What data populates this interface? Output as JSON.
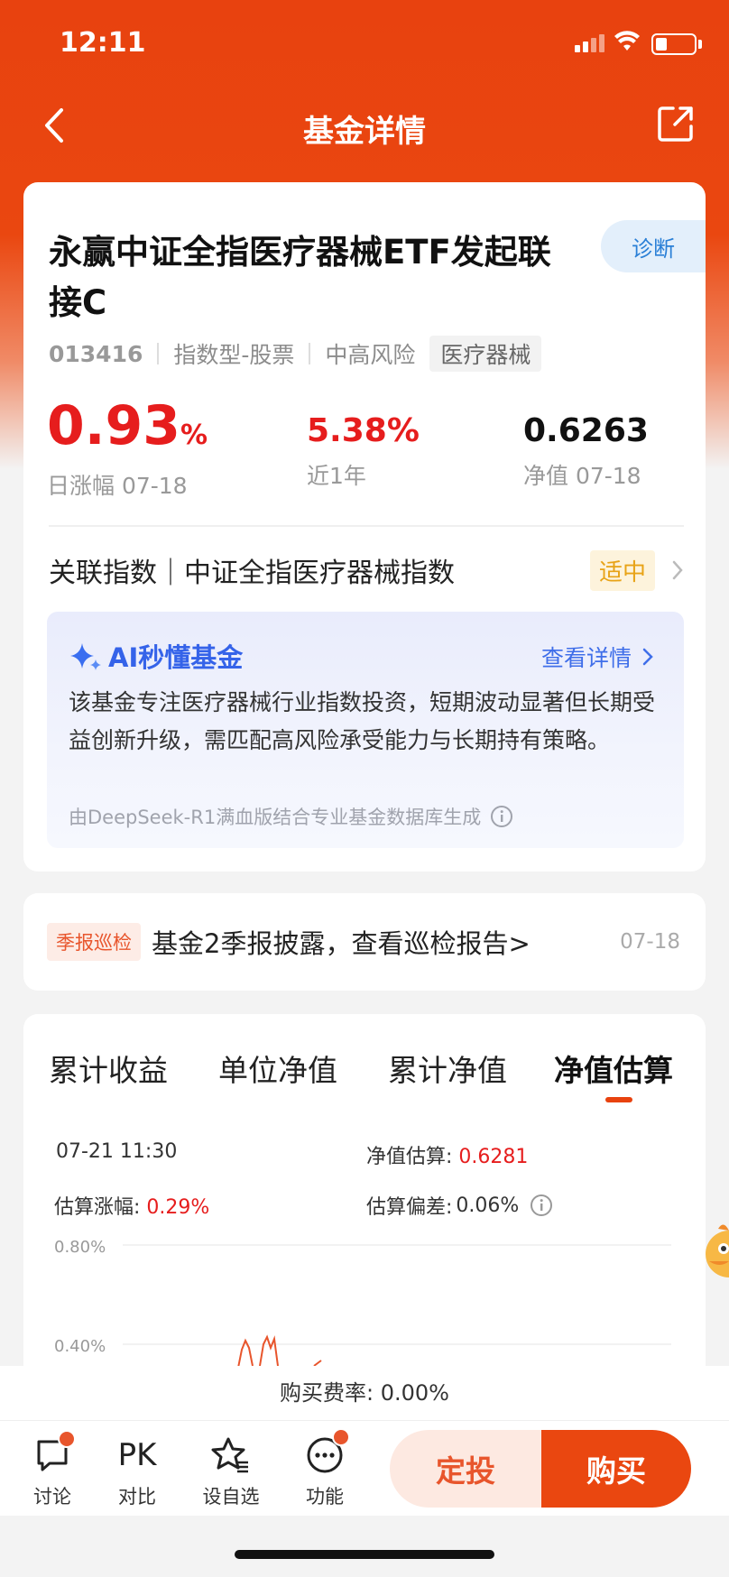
{
  "status": {
    "time": "12:11"
  },
  "nav": {
    "title": "基金详情"
  },
  "fund": {
    "name": "永赢中证全指医疗器械ETF发起联接C",
    "diagnose_label": "诊断",
    "code": "013416",
    "type": "指数型-股票",
    "risk": "中高风险",
    "sector_tag": "医疗器械",
    "daily_change_value": "0.93",
    "daily_change_unit": "%",
    "daily_change_label": "日涨幅 07-18",
    "one_year_value": "5.38%",
    "one_year_label": "近1年",
    "nav_value": "0.6263",
    "nav_label": "净值 07-18"
  },
  "index": {
    "text": "关联指数｜中证全指医疗器械指数",
    "badge": "适中"
  },
  "ai": {
    "title": "AI秒懂基金",
    "more_label": "查看详情",
    "body": "该基金专注医疗器械行业指数投资，短期波动显著但长期受益创新升级，需匹配高风险承受能力与长期持有策略。",
    "footer": "由DeepSeek-R1满血版结合专业基金数据库生成"
  },
  "news": {
    "tag": "季报巡检",
    "text": "基金2季报披露，查看巡检报告>",
    "date": "07-18"
  },
  "chart_tabs": [
    "累计收益",
    "单位净值",
    "累计净值",
    "净值估算"
  ],
  "estimate": {
    "datetime": "07-21 11:30",
    "nav_est_label": "净值估算:",
    "nav_est_value": "0.6281",
    "chg_label": "估算涨幅:",
    "chg_value": "0.29%",
    "dev_label": "估算偏差:",
    "dev_value": "0.06%"
  },
  "chart_data": {
    "type": "line",
    "y_ticks": [
      "0.80%",
      "0.40%"
    ],
    "ylim": [
      0.0,
      0.8
    ],
    "grid": true
  },
  "fee": {
    "text": "购买费率: 0.00%"
  },
  "bottom": {
    "items": [
      {
        "label": "讨论",
        "icon": "chat-icon"
      },
      {
        "label": "对比",
        "icon": "pk-icon",
        "icon_text": "PK"
      },
      {
        "label": "设自选",
        "icon": "star-icon"
      },
      {
        "label": "功能",
        "icon": "more-icon"
      }
    ],
    "dingtou_label": "定投",
    "buy_label": "购买"
  },
  "colors": {
    "brand": "#ea4710",
    "up": "#e61d1d",
    "ai_blue": "#3563e9"
  }
}
